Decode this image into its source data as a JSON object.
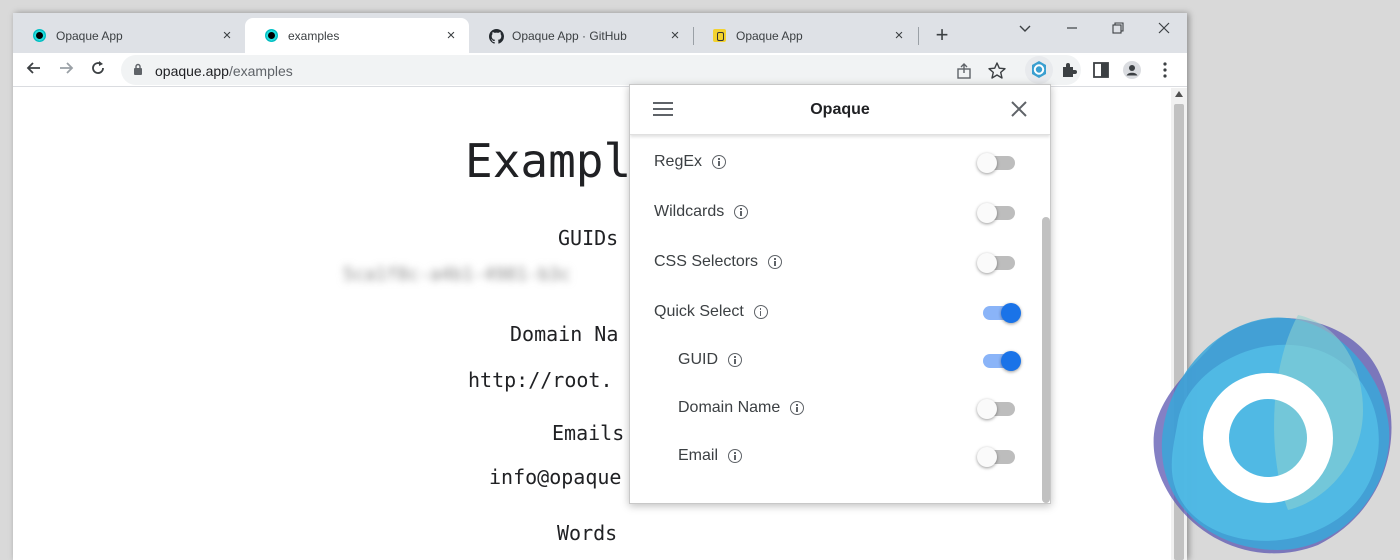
{
  "tabs": [
    {
      "label": "Opaque App",
      "favicon": "opaque-dark-icon",
      "close": "×",
      "active": false
    },
    {
      "label": "examples",
      "favicon": "opaque-dark-icon",
      "close": "×",
      "active": true
    },
    {
      "label": "Opaque App · GitHub",
      "favicon": "github-icon",
      "close": "×",
      "active": false
    },
    {
      "label": "Opaque App",
      "favicon": "yellow-app-icon",
      "close": "×",
      "active": false
    }
  ],
  "new_tab": "+",
  "window_controls": {
    "dropdown": "⌄",
    "minimize": "—",
    "restore": "❐",
    "close": "✕"
  },
  "toolbar": {
    "back": "←",
    "forward": "→",
    "reload": "⟳"
  },
  "omnibox": {
    "host": "opaque.app",
    "path": "/examples"
  },
  "page": {
    "title": "Exampl",
    "guids_heading": "GUIDs",
    "blurred_value": "5ca1f8c-a4b1-4981-b3c",
    "domain_heading": "Domain Na",
    "domain_value": "http://root.",
    "emails_heading": "Emails",
    "email_value": "info@opaque",
    "words_heading": "Words"
  },
  "popup": {
    "title": "Opaque",
    "settings": [
      {
        "label": "RegEx",
        "enabled": false,
        "indent": false
      },
      {
        "label": "Wildcards",
        "enabled": false,
        "indent": false
      },
      {
        "label": "CSS Selectors",
        "enabled": false,
        "indent": false
      },
      {
        "label": "Quick Select",
        "enabled": true,
        "indent": false
      },
      {
        "label": "GUID",
        "enabled": true,
        "indent": true
      },
      {
        "label": "Domain Name",
        "enabled": false,
        "indent": true
      },
      {
        "label": "Email",
        "enabled": false,
        "indent": true
      }
    ]
  },
  "colors": {
    "accent": "#1a73e8",
    "accent_track": "#8ab4f8",
    "logo_teal": "#3a9fd0",
    "logo_purple": "#5b56b0"
  }
}
